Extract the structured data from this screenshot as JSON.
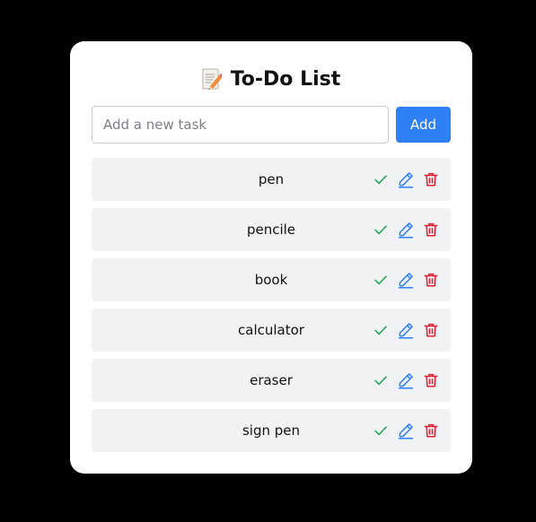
{
  "header": {
    "title": "To-Do List",
    "title_icon": "memo-pencil-icon"
  },
  "add_form": {
    "placeholder": "Add a new task",
    "value": "",
    "button_label": "Add"
  },
  "tasks": [
    {
      "label": "pen"
    },
    {
      "label": "pencile"
    },
    {
      "label": "book"
    },
    {
      "label": "calculator"
    },
    {
      "label": "eraser"
    },
    {
      "label": "sign pen"
    }
  ],
  "task_actions": {
    "complete_icon": "check-icon",
    "edit_icon": "pencil-edit-icon",
    "delete_icon": "trash-icon"
  },
  "colors": {
    "page_background": "#000000",
    "card_background": "#ffffff",
    "accent": "#2f7ff5",
    "item_background": "#f1f2f4",
    "complete": "#16a34a",
    "edit": "#2f7ff5",
    "delete": "#e11d2e"
  }
}
